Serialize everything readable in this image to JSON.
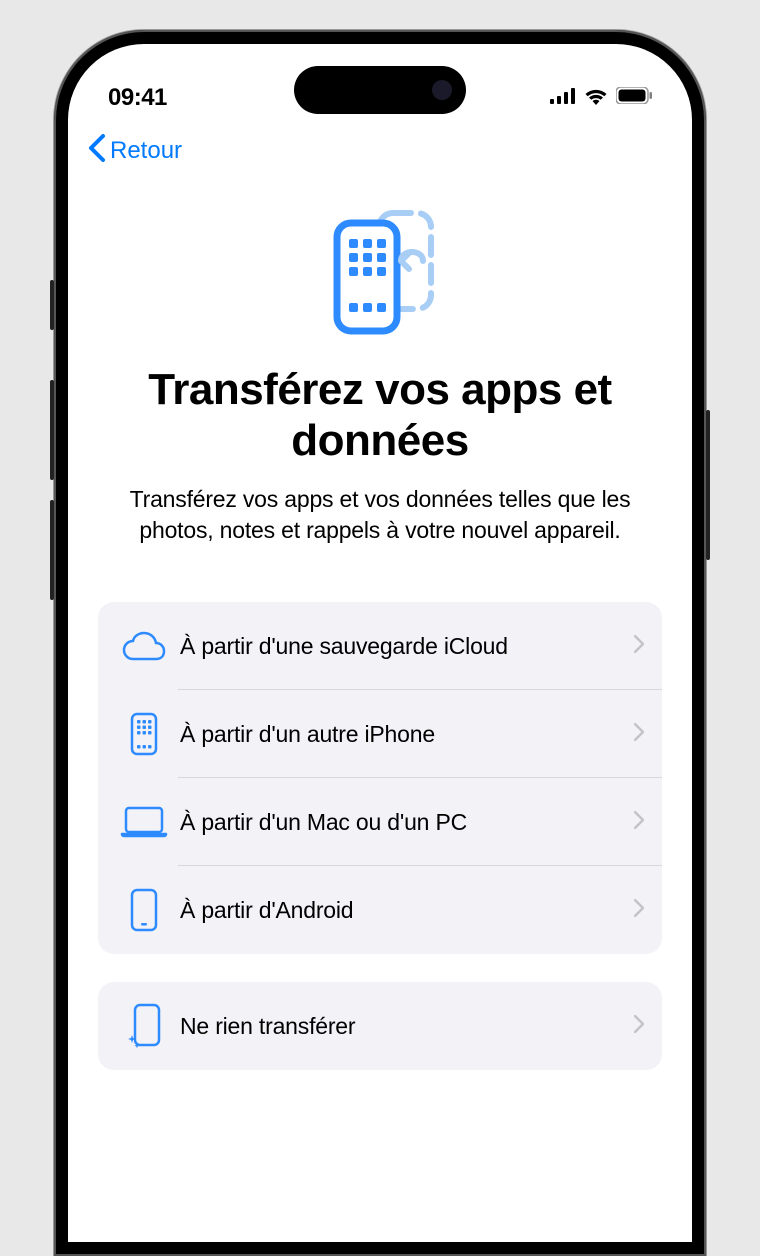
{
  "status": {
    "time": "09:41"
  },
  "nav": {
    "back": "Retour"
  },
  "header": {
    "title": "Transférez vos apps et données",
    "subtitle": "Transférez vos apps et vos données telles que les photos, notes et rappels à votre nouvel appareil."
  },
  "options": [
    {
      "label": "À partir d'une sauvegarde iCloud",
      "icon": "cloud"
    },
    {
      "label": "À partir d'un autre iPhone",
      "icon": "iphone-apps"
    },
    {
      "label": "À partir d'un Mac ou d'un PC",
      "icon": "laptop"
    },
    {
      "label": "À partir d'Android",
      "icon": "phone-outline"
    }
  ],
  "secondary": [
    {
      "label": "Ne rien transférer",
      "icon": "phone-sparkle"
    }
  ],
  "colors": {
    "accent": "#007aff",
    "accent_light": "#a8cef5"
  }
}
